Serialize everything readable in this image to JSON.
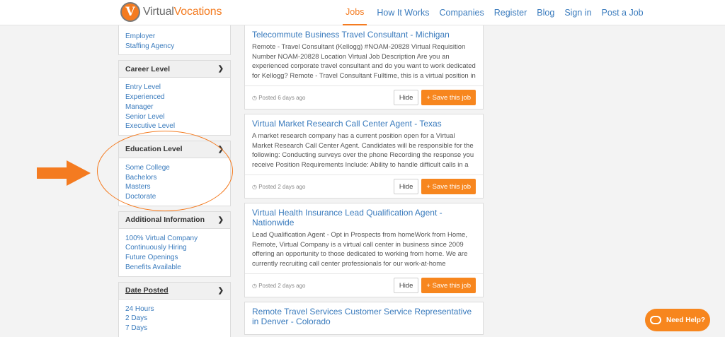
{
  "logo": {
    "badge": "V",
    "text_a": "Virtual",
    "text_b": "Vocations"
  },
  "nav": {
    "items": [
      {
        "label": "Jobs",
        "active": true
      },
      {
        "label": "How It Works"
      },
      {
        "label": "Companies"
      },
      {
        "label": "Register"
      },
      {
        "label": "Blog"
      },
      {
        "label": "Sign in"
      },
      {
        "label": "Post a Job"
      }
    ]
  },
  "sidebar": {
    "top_links": [
      "Employer",
      "Staffing Agency"
    ],
    "career": {
      "title": "Career Level",
      "items": [
        "Entry Level",
        "Experienced",
        "Manager",
        "Senior Level",
        "Executive Level"
      ]
    },
    "education": {
      "title": "Education Level",
      "items": [
        "Some College",
        "Bachelors",
        "Masters",
        "Doctorate"
      ]
    },
    "additional": {
      "title": "Additional Information",
      "items": [
        "100% Virtual Company",
        "Continuously Hiring",
        "Future Openings",
        "Benefits Available"
      ]
    },
    "date": {
      "title": "Date Posted",
      "items": [
        "24 Hours",
        "2 Days",
        "7 Days"
      ]
    }
  },
  "jobs": [
    {
      "title": "Telecommute Business Travel Consultant - Michigan",
      "desc": "Remote - Travel Consultant (Kellogg) #NOAM-20828 Virtual Requisition Number NOAM-20828 Location Virtual Job Description Are you an experienced corporate travel consultant and do you want to work dedicated for Kellogg? Remote - Travel Consultant Fulltime, this is a virtual position in",
      "posted": "Posted 6 days ago"
    },
    {
      "title": "Virtual Market Research Call Center Agent - Texas",
      "desc": "A market research company has a current position open for a Virtual Market Research Call Center Agent. Candidates will be responsible for the following: Conducting surveys over the phone Recording the response you receive Position Requirements Include: Ability to handle difficult calls in a",
      "posted": "Posted 2 days ago"
    },
    {
      "title": "Virtual Health Insurance Lead Qualification Agent - Nationwide",
      "desc": "Lead Qualification Agent - Opt in Prospects from homeWork from Home, Remote, Virtual Company is a virtual call center in business since 2009 offering an opportunity to those dedicated to working from home. We are currently recruiting call center professionals for our work-at-home",
      "posted": "Posted 2 days ago"
    },
    {
      "title": "Remote Travel Services Customer Service Representative in Denver - Colorado",
      "desc": "",
      "posted": ""
    }
  ],
  "buttons": {
    "hide": "Hide",
    "save": "+ Save this job"
  },
  "help": {
    "label": "Need Help?"
  },
  "colors": {
    "accent": "#f47b20",
    "link": "#3a7bbd"
  }
}
